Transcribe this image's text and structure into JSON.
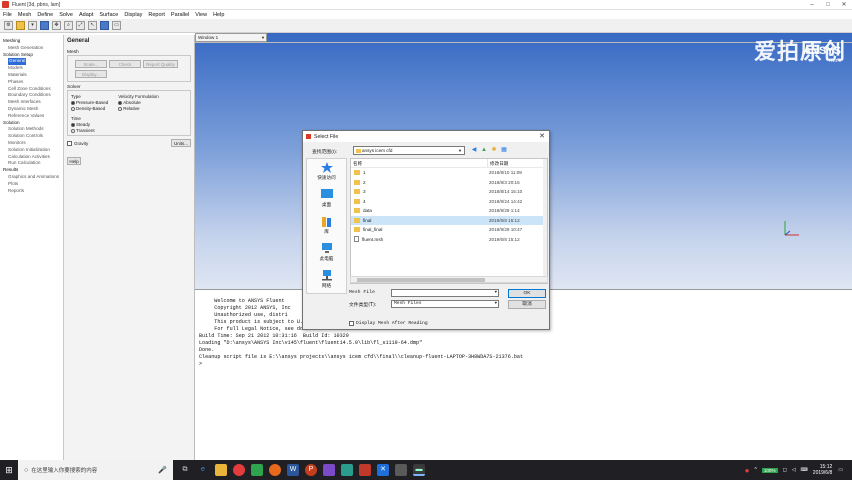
{
  "window": {
    "title": "Fluent  [3d, pbns, lam]",
    "controls": [
      "–",
      "□",
      "✕"
    ]
  },
  "menubar": [
    "File",
    "Mesh",
    "Define",
    "Solve",
    "Adapt",
    "Surface",
    "Display",
    "Report",
    "Parallel",
    "View",
    "Help"
  ],
  "tree": [
    {
      "label": "Meshing",
      "level": 0
    },
    {
      "label": "Mesh Generation",
      "level": 1
    },
    {
      "label": "Solution Setup",
      "level": 0
    },
    {
      "label": "General",
      "level": 1,
      "selected": true
    },
    {
      "label": "Models",
      "level": 1
    },
    {
      "label": "Materials",
      "level": 1
    },
    {
      "label": "Phases",
      "level": 1
    },
    {
      "label": "Cell Zone Conditions",
      "level": 1
    },
    {
      "label": "Boundary Conditions",
      "level": 1
    },
    {
      "label": "Mesh Interfaces",
      "level": 1
    },
    {
      "label": "Dynamic Mesh",
      "level": 1
    },
    {
      "label": "Reference Values",
      "level": 1
    },
    {
      "label": "Solution",
      "level": 0
    },
    {
      "label": "Solution Methods",
      "level": 1
    },
    {
      "label": "Solution Controls",
      "level": 1
    },
    {
      "label": "Monitors",
      "level": 1
    },
    {
      "label": "Solution Initialization",
      "level": 1
    },
    {
      "label": "Calculation Activities",
      "level": 1
    },
    {
      "label": "Run Calculation",
      "level": 1
    },
    {
      "label": "Results",
      "level": 0
    },
    {
      "label": "Graphics and Animations",
      "level": 1
    },
    {
      "label": "Plots",
      "level": 1
    },
    {
      "label": "Reports",
      "level": 1
    }
  ],
  "general": {
    "heading": "General",
    "mesh_label": "Mesh",
    "scale": "Scale...",
    "check": "Check",
    "report_quality": "Report Quality",
    "display": "Display...",
    "solver_label": "Solver",
    "type_label": "Type",
    "type_opt1": "Pressure-Based",
    "type_opt2": "Density-Based",
    "vel_label": "Velocity Formulation",
    "vel_opt1": "Absolute",
    "vel_opt2": "Relative",
    "time_label": "Time",
    "time_opt1": "Steady",
    "time_opt2": "Transient",
    "gravity": "Gravity",
    "units": "Units...",
    "help": "Help"
  },
  "graphics": {
    "window_select": "Window 1",
    "watermark": "爱拍原创",
    "logo": "ANSYS",
    "version": "R14.5"
  },
  "console": {
    "lines": [
      "     Welcome to ANSYS Fluent",
      "",
      "     Copyright 2012 ANSYS, Inc",
      "     Unauthorized use, distri                               ohibited.",
      "     This product is subject to U.S. laws governing export and re-export.",
      "     For full Legal Notice, see documentation.",
      "",
      "Build Time: Sep 21 2012 10:31:16  Build Id: 10329",
      "Loading \"D:\\ansys\\ANSYS Inc\\v145\\fluent\\fluent14.5.0\\lib\\fl_s1119-64.dmp\"",
      "Done.",
      "",
      "",
      "",
      "Cleanup script file is E:\\\\ansys projects\\\\ansys icem cfd\\\\final\\\\cleanup-fluent-LAPTOP-3H8WDA7S-21376.bat",
      "",
      ">"
    ]
  },
  "dialog": {
    "title": "Select File",
    "lookin_label": "查找范围(I):",
    "lookin_value": "ansys icem cfd",
    "places": [
      "快速访问",
      "桌面",
      "库",
      "此电脑",
      "网络"
    ],
    "col_name": "名称",
    "col_date": "修改日期",
    "files": [
      {
        "name": "1",
        "date": "2018/8/10 11:09",
        "type": "folder"
      },
      {
        "name": "2",
        "date": "2018/8/3 20:15",
        "type": "folder"
      },
      {
        "name": "3",
        "date": "2018/8/14 15:10",
        "type": "folder"
      },
      {
        "name": "4",
        "date": "2018/9/24 14:42",
        "type": "folder"
      },
      {
        "name": "data",
        "date": "2018/9/29 1:14",
        "type": "folder"
      },
      {
        "name": "final",
        "date": "2019/6/8 15:12",
        "type": "folder",
        "selected": true
      },
      {
        "name": "final_final",
        "date": "2018/9/29 10:47",
        "type": "folder"
      },
      {
        "name": "fluent.msh",
        "date": "2019/6/8 15:12",
        "type": "file"
      }
    ],
    "file_label": "Mesh File",
    "file_value": "",
    "type_label": "文件类型(T):",
    "type_value": "Mesh Files",
    "ok": "OK",
    "cancel": "取消",
    "display_mesh": "Display Mesh After Reading"
  },
  "taskbar": {
    "search_placeholder": "在这里输入你要搜索的内容",
    "battery": "100%",
    "time": "15:12",
    "date": "2019/6/8"
  }
}
